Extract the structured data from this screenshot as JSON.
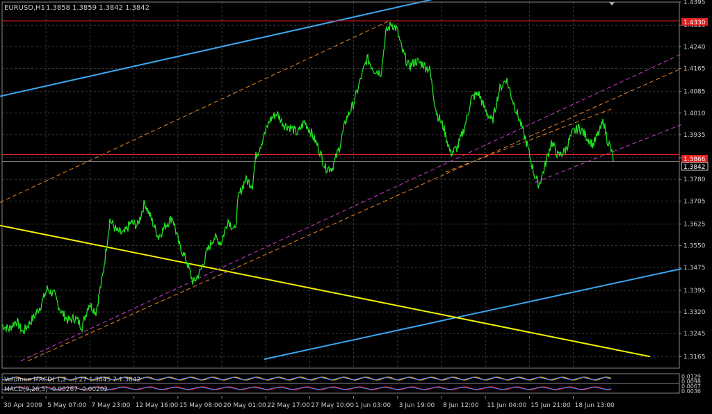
{
  "chart_data": {
    "type": "line",
    "title": "EURUSD,H1",
    "ohlc": [
      "1.3858",
      "1.3859",
      "1.3842",
      "1.3842"
    ],
    "ylim": [
      1.3125,
      1.4395
    ],
    "y_ticks": [
      "1.4395",
      "1.4315",
      "1.4240",
      "1.4165",
      "1.4085",
      "1.4010",
      "1.3935",
      "1.3855",
      "1.3780",
      "1.3705",
      "1.3625",
      "1.3550",
      "1.3475",
      "1.3395",
      "1.3320",
      "1.3245",
      "1.3165"
    ],
    "x_ticks": [
      "30 Apr 2009",
      "5 May 07:00",
      "7 May 23:00",
      "12 May 16:00",
      "15 May 08:00",
      "20 May 01:00",
      "22 May 17:00",
      "27 May 10:00",
      "1 Jun 03:00",
      "3 Jun 19:00",
      "8 Jun 12:00",
      "11 Jun 04:00",
      "15 Jun 21:00",
      "18 Jun 13:00"
    ],
    "price_labels": {
      "high_line": "1.4330",
      "mid_line": "1.3866",
      "current": "1.3842"
    },
    "horizontal_lines": [
      1.433,
      1.3866
    ],
    "trend_lines": [
      {
        "kind": "upper-blue",
        "color": "#3aa6ee",
        "from": [
          0,
          1.4068
        ],
        "to": [
          623,
          1.4405
        ]
      },
      {
        "kind": "lower-blue",
        "color": "#3aa6ee",
        "from": [
          380,
          1.3156
        ],
        "to": [
          980,
          1.347
        ]
      },
      {
        "kind": "yellow",
        "color": "#f0f000",
        "from": [
          0,
          1.362
        ],
        "to": [
          935,
          1.3165
        ]
      }
    ],
    "channels": [
      {
        "kind": "orange-upper",
        "color": "#f08a28",
        "from": [
          0,
          1.37
        ],
        "to": [
          560,
          1.433
        ]
      },
      {
        "kind": "orange-lower",
        "color": "#f08a28",
        "from": [
          40,
          1.315
        ],
        "to": [
          980,
          1.4165
        ]
      },
      {
        "kind": "magenta-lower",
        "color": "#d040d0",
        "from": [
          30,
          1.315
        ],
        "to": [
          980,
          1.4215
        ]
      },
      {
        "kind": "magenta-short",
        "color": "#d040d0",
        "from": [
          770,
          1.377
        ],
        "to": [
          980,
          1.397
        ]
      },
      {
        "kind": "orange-short",
        "color": "#f08a28",
        "from": [
          640,
          1.3805
        ],
        "to": [
          880,
          1.4025
        ]
      }
    ],
    "price_series": {
      "color": "#22e022",
      "anchors": [
        [
          0,
          1.3275
        ],
        [
          10,
          1.326
        ],
        [
          20,
          1.329
        ],
        [
          30,
          1.325
        ],
        [
          45,
          1.33
        ],
        [
          55,
          1.334
        ],
        [
          65,
          1.34
        ],
        [
          75,
          1.338
        ],
        [
          85,
          1.332
        ],
        [
          95,
          1.329
        ],
        [
          105,
          1.33
        ],
        [
          115,
          1.327
        ],
        [
          125,
          1.335
        ],
        [
          135,
          1.332
        ],
        [
          145,
          1.345
        ],
        [
          155,
          1.364
        ],
        [
          165,
          1.36
        ],
        [
          175,
          1.359
        ],
        [
          185,
          1.363
        ],
        [
          195,
          1.362
        ],
        [
          205,
          1.37
        ],
        [
          215,
          1.364
        ],
        [
          225,
          1.358
        ],
        [
          235,
          1.362
        ],
        [
          245,
          1.365
        ],
        [
          255,
          1.355
        ],
        [
          265,
          1.35
        ],
        [
          275,
          1.342
        ],
        [
          285,
          1.346
        ],
        [
          295,
          1.353
        ],
        [
          305,
          1.358
        ],
        [
          315,
          1.356
        ],
        [
          325,
          1.364
        ],
        [
          335,
          1.36
        ],
        [
          340,
          1.372
        ],
        [
          350,
          1.378
        ],
        [
          360,
          1.376
        ],
        [
          365,
          1.386
        ],
        [
          375,
          1.392
        ],
        [
          385,
          1.3985
        ],
        [
          395,
          1.401
        ],
        [
          405,
          1.397
        ],
        [
          415,
          1.396
        ],
        [
          425,
          1.394
        ],
        [
          435,
          1.398
        ],
        [
          445,
          1.394
        ],
        [
          455,
          1.389
        ],
        [
          465,
          1.382
        ],
        [
          475,
          1.382
        ],
        [
          485,
          1.389
        ],
        [
          495,
          1.399
        ],
        [
          505,
          1.404
        ],
        [
          515,
          1.412
        ],
        [
          525,
          1.42
        ],
        [
          535,
          1.416
        ],
        [
          545,
          1.415
        ],
        [
          552,
          1.429
        ],
        [
          560,
          1.432
        ],
        [
          568,
          1.43
        ],
        [
          575,
          1.423
        ],
        [
          585,
          1.417
        ],
        [
          595,
          1.419
        ],
        [
          605,
          1.418
        ],
        [
          615,
          1.416
        ],
        [
          620,
          1.408
        ],
        [
          625,
          1.401
        ],
        [
          635,
          1.396
        ],
        [
          645,
          1.387
        ],
        [
          655,
          1.389
        ],
        [
          665,
          1.396
        ],
        [
          675,
          1.406
        ],
        [
          685,
          1.408
        ],
        [
          695,
          1.402
        ],
        [
          705,
          1.398
        ],
        [
          715,
          1.409
        ],
        [
          725,
          1.413
        ],
        [
          735,
          1.405
        ],
        [
          745,
          1.398
        ],
        [
          755,
          1.39
        ],
        [
          765,
          1.38
        ],
        [
          772,
          1.376
        ],
        [
          780,
          1.382
        ],
        [
          790,
          1.391
        ],
        [
          800,
          1.386
        ],
        [
          810,
          1.388
        ],
        [
          820,
          1.394
        ],
        [
          830,
          1.396
        ],
        [
          840,
          1.393
        ],
        [
          850,
          1.39
        ],
        [
          860,
          1.395
        ],
        [
          865,
          1.3985
        ],
        [
          870,
          1.392
        ],
        [
          875,
          1.389
        ],
        [
          880,
          1.3842
        ]
      ]
    },
    "indicators": [
      {
        "label": "Volumen MACD( 1,2 ...) 27 1.3845 7 1.3842",
        "color": "#e0a020"
      },
      {
        "label": "MACD(9,26,5) -0.00267 -0.00202",
        "color": "#e02020"
      }
    ],
    "indicator_scale": [
      "0.0129",
      "0.0098",
      "0.0067",
      "0.0036"
    ]
  }
}
